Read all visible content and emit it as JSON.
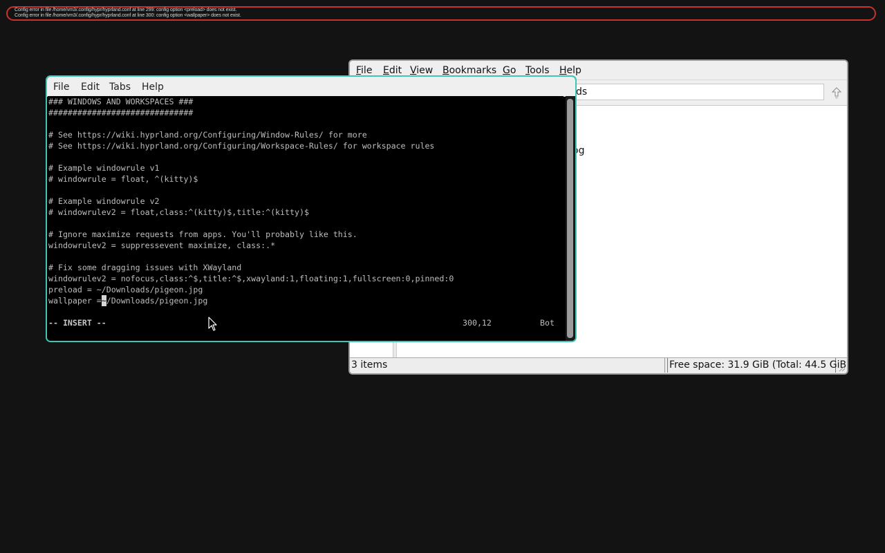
{
  "error_banner": {
    "lines": [
      "Config error in file /home/vm3/.config/hypr/hyprland.conf at line 299: config option <preload> does not exist.",
      "Config error in file /home/vm3/.config/hypr/hyprland.conf at line 300: config option <wallpaper> does not exist."
    ],
    "border_color": "#c8322f"
  },
  "file_manager": {
    "menu": [
      {
        "mnemonic": "F",
        "rest": "ile"
      },
      {
        "mnemonic": "E",
        "rest": "dit"
      },
      {
        "mnemonic": "V",
        "rest": "iew"
      },
      {
        "mnemonic": "B",
        "rest": "ookmarks"
      },
      {
        "mnemonic": "G",
        "rest": "o"
      },
      {
        "mnemonic": "T",
        "rest": "ools"
      },
      {
        "mnemonic": "H",
        "rest": "elp"
      }
    ],
    "location_value": "ds",
    "go_icon": "jump-arrow-icon",
    "files": [
      "og"
    ],
    "status_items": "3 items",
    "status_space": "Free space: 31.9 GiB (Total: 44.5 GiB)"
  },
  "terminal": {
    "menu": [
      "File",
      "Edit",
      "Tabs",
      "Help"
    ],
    "border_color": "#3fc6b2",
    "lines": [
      "### WINDOWS AND WORKSPACES ###",
      "##############################",
      "",
      "# See https://wiki.hyprland.org/Configuring/Window-Rules/ for more",
      "# See https://wiki.hyprland.org/Configuring/Workspace-Rules/ for workspace rules",
      "",
      "# Example windowrule v1",
      "# windowrule = float, ^(kitty)$",
      "",
      "# Example windowrule v2",
      "# windowrulev2 = float,class:^(kitty)$,title:^(kitty)$",
      "",
      "# Ignore maximize requests from apps. You'll probably like this.",
      "windowrulev2 = suppressevent maximize, class:.*",
      "",
      "# Fix some dragging issues with XWayland",
      "windowrulev2 = nofocus,class:^$,title:^$,xwayland:1,floating:1,fullscreen:0,pinned:0",
      "preload = ~/Downloads/pigeon.jpg"
    ],
    "cursor_line": {
      "before": "wallpaper =",
      "cursor_char": "~",
      "after": "/Downloads/pigeon.jpg"
    },
    "status": {
      "mode": "-- INSERT --",
      "position": "300,12",
      "scroll": "Bot"
    }
  }
}
